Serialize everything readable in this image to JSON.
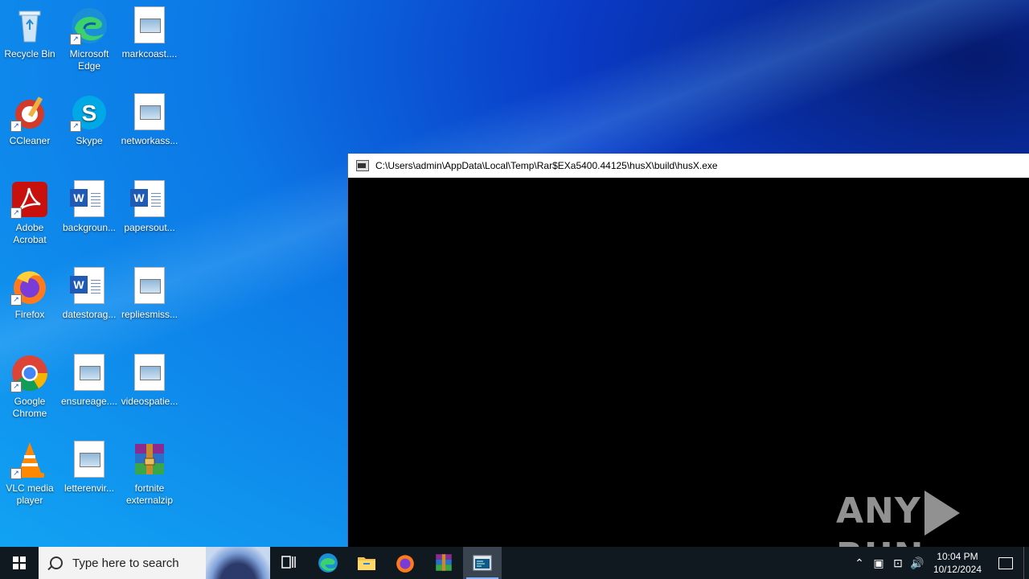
{
  "desktop": {
    "icons": [
      {
        "label": "Recycle Bin",
        "icon": "recycle-bin-icon"
      },
      {
        "label": "Microsoft Edge",
        "icon": "edge-icon"
      },
      {
        "label": "markcoast....",
        "icon": "image-file-icon"
      },
      {
        "label": "CCleaner",
        "icon": "ccleaner-icon"
      },
      {
        "label": "Skype",
        "icon": "skype-icon"
      },
      {
        "label": "networkass...",
        "icon": "image-file-icon"
      },
      {
        "label": "Adobe Acrobat",
        "icon": "acrobat-icon"
      },
      {
        "label": "backgroun...",
        "icon": "word-doc-icon"
      },
      {
        "label": "papersout...",
        "icon": "word-doc-icon"
      },
      {
        "label": "Firefox",
        "icon": "firefox-icon"
      },
      {
        "label": "datestorag...",
        "icon": "word-doc-icon"
      },
      {
        "label": "repliesmiss...",
        "icon": "image-file-icon"
      },
      {
        "label": "Google Chrome",
        "icon": "chrome-icon"
      },
      {
        "label": "ensureage....",
        "icon": "image-file-icon"
      },
      {
        "label": "videospatie...",
        "icon": "image-file-icon"
      },
      {
        "label": "VLC media player",
        "icon": "vlc-icon"
      },
      {
        "label": "letterenvir...",
        "icon": "image-file-icon"
      },
      {
        "label": "fortnite externalzip",
        "icon": "winrar-archive-icon"
      }
    ]
  },
  "console_window": {
    "title": "C:\\Users\\admin\\AppData\\Local\\Temp\\Rar$EXa5400.44125\\husX\\build\\husX.exe"
  },
  "watermark": {
    "left": "ANY",
    "right": "RUN"
  },
  "taskbar": {
    "search_placeholder": "Type here to search",
    "apps": [
      "task-view-icon",
      "edge-icon",
      "file-explorer-icon",
      "firefox-icon",
      "winrar-icon",
      "console-icon"
    ],
    "clock_time": "10:04 PM",
    "clock_date": "10/12/2024"
  },
  "colors": {
    "taskbar": "#101820",
    "console_bg": "#000000",
    "accent": "#8ab4f8"
  }
}
